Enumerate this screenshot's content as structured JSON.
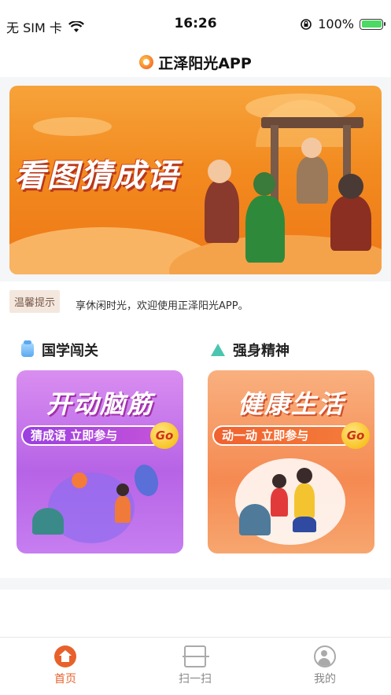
{
  "status_bar": {
    "carrier": "无 SIM 卡",
    "time": "16:26",
    "battery": "100%",
    "battery_level": 1.0,
    "icons": [
      "wifi-icon",
      "rotation-lock-icon",
      "battery-icon"
    ]
  },
  "header": {
    "title": "正泽阳光APP",
    "logo_icon": "sun-logo-icon"
  },
  "banner": {
    "title": "看图猜成语"
  },
  "notice": {
    "badge": "温馨提示",
    "text": "享休闲时光，欢迎使用正泽阳光APP。"
  },
  "sections": [
    {
      "label": "国学闯关",
      "icon": "book-bag-icon",
      "card_title": "开动脑筋",
      "card_action": "猜成语  立即参与",
      "go": "Go"
    },
    {
      "label": "强身精神",
      "icon": "lotus-icon",
      "card_title": "健康生活",
      "card_action": "动一动  立即参与",
      "go": "Go"
    }
  ],
  "tabbar": {
    "items": [
      {
        "label": "首页",
        "icon": "home-icon",
        "active": true
      },
      {
        "label": "扫一扫",
        "icon": "scan-icon",
        "active": false
      },
      {
        "label": "我的",
        "icon": "profile-icon",
        "active": false
      }
    ],
    "active_color": "#e8612c"
  }
}
